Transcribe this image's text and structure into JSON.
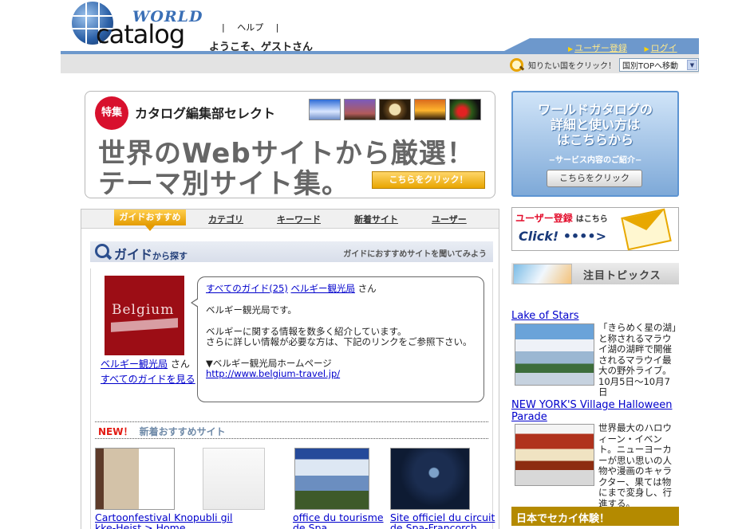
{
  "header": {
    "logo_world": "WORLD",
    "logo_catalog": "catalog",
    "help_sep_left": "|",
    "help": "ヘルプ",
    "help_sep_right": "|",
    "welcome": "ようこそ、ゲストさん",
    "user_register": "ユーザー登録",
    "login": "ログイン",
    "country_prompt": "知りたい国をクリック！",
    "country_select_value": "国別TOPへ移動"
  },
  "feature": {
    "badge": "特集",
    "select_label": "カタログ編集部セレクト",
    "headline1": "世界のWebサイトから厳選！",
    "headline2": "テーマ別サイト集。",
    "button": "こちらをクリック！"
  },
  "howto": {
    "title_line1": "ワールドカタログの",
    "title_line2": "詳細と使い方は",
    "title_line3": "はこちらから",
    "subtitle": "−サービス内容のご紹介−",
    "button": "こちらをクリック"
  },
  "register": {
    "title": "ユーザー登録",
    "title_suffix": "はこちら",
    "click": "Click! ••••>"
  },
  "topics": {
    "header": "注目トピックス",
    "items": [
      {
        "title": "Lake of Stars",
        "text": "「きらめく星の湖」と称されるマラウイ湖の湖畔で開催されるマラウイ最大の野外ライブ。10月5日〜10月7日"
      },
      {
        "title": "NEW YORK'S Village Halloween Parade",
        "text": "世界最大のハロウィーン・イベント。ニューヨーカーが思い思いの人物や漫画のキャラクター、果ては物にまで変身し、行進する。"
      }
    ]
  },
  "japan_bar": "日本でセカイ体験！",
  "tabs": {
    "active": "ガイドおすすめ",
    "category": "カテゴリ",
    "keyword": "キーワード",
    "new_sites": "新着サイト",
    "user": "ユーザー"
  },
  "guide": {
    "head_title": "ガイド",
    "head_suffix": "から探す",
    "head_right": "ガイドにおすすめサイトを聞いてみよう",
    "logo_text": "Belgium",
    "name": "ベルギー観光局",
    "san": "さん",
    "see_all": "すべてのガイドを見る",
    "bubble": {
      "all_guides": "すべてのガイド(25)",
      "guide_name": "ベルギー観光局",
      "san": "さん",
      "line1": "ベルギー観光局です。",
      "line2": "ベルギーに関する情報を数多く紹介しています。",
      "line3": "さらに詳しい情報が必要な方は、下記のリンクをご参照下さい。",
      "homepage_label": "▼ベルギー観光局ホームページ",
      "homepage_url": "http://www.belgium-travel.jp/"
    }
  },
  "new_sites": {
    "new_badge": "NEW！",
    "label": "新着おすすめサイト",
    "items": [
      {
        "title_line1": "Cartoonfestival Knopubli gil",
        "title_line2": "kke-Heist > Home"
      },
      {
        "title_line1": "office du tourisme",
        "title_line2": "de Spa"
      },
      {
        "title_line1": "Site officiel du circuit",
        "title_line2": "de Spa-Francorch"
      }
    ]
  }
}
